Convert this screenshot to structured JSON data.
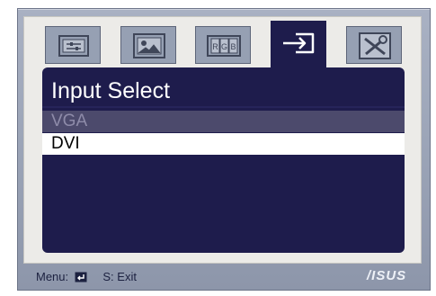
{
  "menu": {
    "tabs": [
      {
        "icon": "sliders-icon"
      },
      {
        "icon": "image-icon"
      },
      {
        "icon": "rgb-color-icon",
        "label": "RGB"
      },
      {
        "icon": "input-select-icon",
        "active": true
      },
      {
        "icon": "tools-icon"
      }
    ],
    "title": "Input Select",
    "options": [
      {
        "label": "VGA",
        "state": "disabled"
      },
      {
        "label": "DVI",
        "state": "selected"
      }
    ]
  },
  "footer": {
    "menu_label": "Menu:",
    "menu_key_icon": "enter-key-icon",
    "exit_label": "S: Exit",
    "brand": "/ISUS"
  },
  "colors": {
    "panel": "#1e1c4c",
    "bezel": "#9aa3b6",
    "frame": "#ecebe8",
    "tab_inactive": "#96a0b3",
    "option_disabled_bg": "#4c4a6c",
    "option_selected_bg": "#ffffff"
  }
}
